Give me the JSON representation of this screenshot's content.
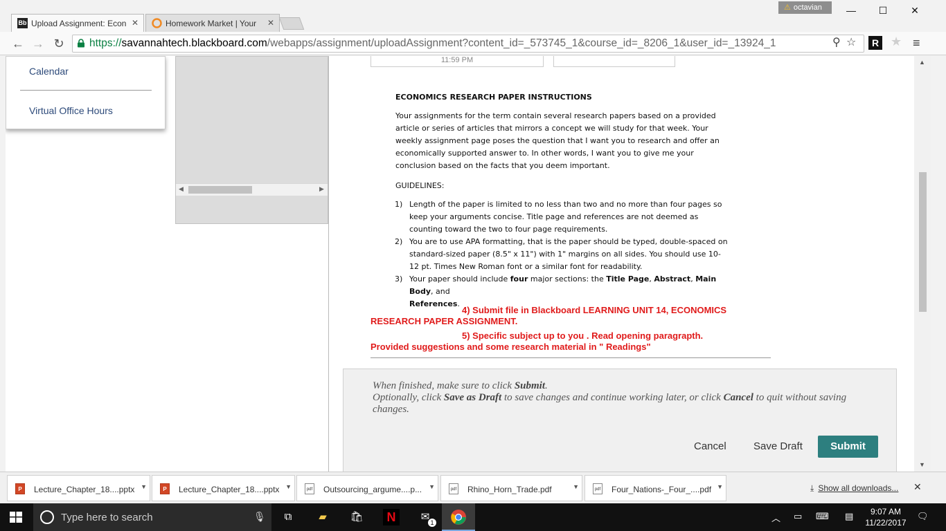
{
  "browser": {
    "tabs": [
      {
        "title": "Upload Assignment: Econ",
        "favicon": "Bb",
        "close": "✕"
      },
      {
        "title": "Homework Market | Your",
        "favicon": "hm",
        "close": "✕"
      }
    ],
    "profile_name": "octavian",
    "url": {
      "scheme": "https://",
      "host": "savannahtech.blackboard.com",
      "path": "/webapps/assignment/uploadAssignment?content_id=_573745_1&course_id=_8206_1&user_id=_13924_1"
    },
    "extension_label": "R"
  },
  "left_menu": {
    "items": [
      {
        "label": "Calendar"
      },
      {
        "label": "Virtual Office Hours"
      }
    ]
  },
  "date_fragment": "11:59 PM",
  "instructions": {
    "title": "ECONOMICS RESEARCH PAPER INSTRUCTIONS",
    "intro": "Your assignments for the term contain several research papers based on a provided article or series of articles that mirrors a concept we will study for that week. Your weekly assignment page poses the question that I want you to research and offer an economically supported answer to. In other words, I want you to give me your conclusion based on the facts that you deem important.",
    "guidelines_heading": "GUIDELINES:",
    "guidelines": [
      {
        "num": "1)",
        "text": "Length of the paper is limited to no less than two and no more than four pages so keep your arguments concise. Title page and references are not deemed as counting toward the two to four page requirements."
      },
      {
        "num": "2)",
        "text": "You are to use APA formatting, that is the paper should be typed, double-spaced on standard-sized paper (8.5\" x 11\") with 1\" margins on all sides. You should use 10-12 pt. Times New Roman font or a similar font for readability."
      }
    ],
    "g3": {
      "num": "3)",
      "pre": "Your paper should include ",
      "four": "four",
      "mid": " major sections: the ",
      "tp": "Title Page",
      "c1": ", ",
      "ab": "Abstract",
      "c2": ", ",
      "mb": "Main Body",
      "and": ", and",
      "refs": "References",
      "end": "."
    },
    "red_items": [
      {
        "lead": "4)  Submit file in Blackboard LEARNING UNIT 14, ECONOMICS",
        "rest": "RESEARCH PAPER ASSIGNMENT."
      },
      {
        "lead": "5)  Specific subject up to you . Read opening paragrapth.",
        "rest": "Provided suggestions and some research material in \" Readings\""
      }
    ]
  },
  "submit_panel": {
    "line1_pre": "When finished, make sure to click ",
    "line1_b": "Submit",
    "line1_post": ".",
    "line2_pre": "Optionally, click ",
    "line2_b1": "Save as Draft",
    "line2_mid": " to save changes and continue working later, or click ",
    "line2_b2": "Cancel",
    "line2_post": " to quit without saving changes.",
    "cancel": "Cancel",
    "save_draft": "Save Draft",
    "submit": "Submit"
  },
  "downloads": {
    "items": [
      {
        "name": "Lecture_Chapter_18....pptx",
        "type": "ppt"
      },
      {
        "name": "Lecture_Chapter_18....pptx",
        "type": "ppt"
      },
      {
        "name": "Outsourcing_argume....p...",
        "type": "pdf"
      },
      {
        "name": "Rhino_Horn_Trade.pdf",
        "type": "pdf"
      },
      {
        "name": "Four_Nations-_Four_....pdf",
        "type": "pdf"
      }
    ],
    "show_all": "Show all downloads..."
  },
  "taskbar": {
    "search_placeholder": "Type here to search",
    "time": "9:07 AM",
    "date": "11/22/2017",
    "mail_badge": "1"
  }
}
